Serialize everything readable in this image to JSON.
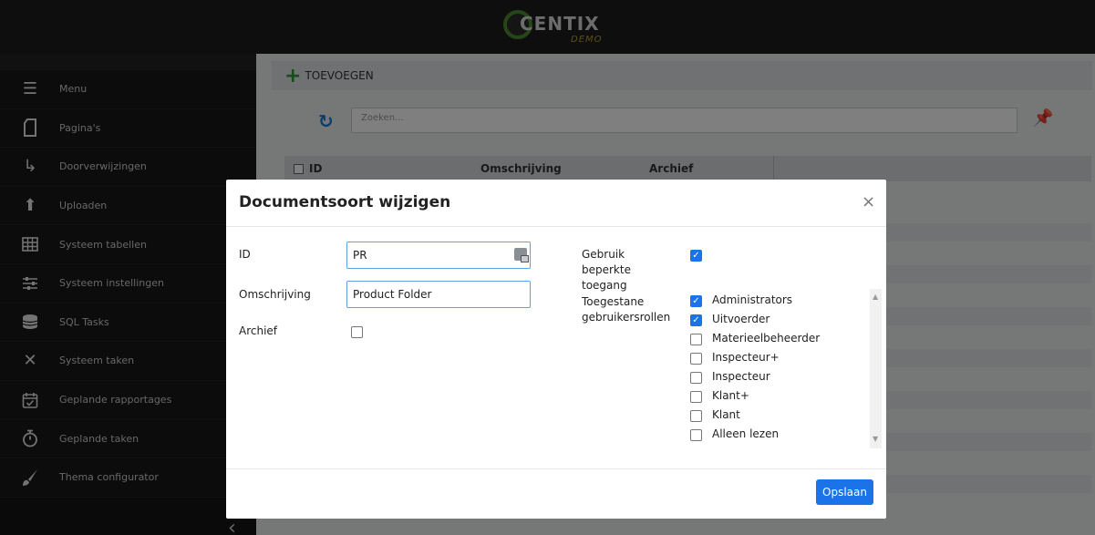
{
  "brand": {
    "name": "CENTIX",
    "tag": "DEMO"
  },
  "sidebar": {
    "items": [
      {
        "label": "Menu",
        "icon": "hamburger-icon"
      },
      {
        "label": "Pagina's",
        "icon": "page-icon"
      },
      {
        "label": "Doorverwijzingen",
        "icon": "redirect-arrow-icon"
      },
      {
        "label": "Uploaden",
        "icon": "upload-icon"
      },
      {
        "label": "Systeem tabellen",
        "icon": "table-icon"
      },
      {
        "label": "Systeem instellingen",
        "icon": "sliders-icon"
      },
      {
        "label": "SQL Tasks",
        "icon": "database-icon"
      },
      {
        "label": "Systeem taken",
        "icon": "tools-icon"
      },
      {
        "label": "Geplande rapportages",
        "icon": "calendar-check-icon"
      },
      {
        "label": "Geplande taken",
        "icon": "stopwatch-icon"
      },
      {
        "label": "Thema configurator",
        "icon": "brush-icon"
      }
    ]
  },
  "main": {
    "add_label": "TOEVOEGEN",
    "search_placeholder": "Zoeken...",
    "columns": [
      "ID",
      "Omschrijving",
      "Archief"
    ]
  },
  "modal": {
    "title": "Documentsoort wijzigen",
    "close": "×",
    "fields": {
      "id_label": "ID",
      "id_value": "PR",
      "omschrijving_label": "Omschrijving",
      "omschrijving_value": "Product Folder",
      "archief_label": "Archief",
      "archief_checked": false,
      "beperkt_label": "Gebruik beperkte toegang",
      "beperkt_checked": true,
      "rollen_label": "Toegestane gebruikersrollen"
    },
    "roles": [
      {
        "name": "Administrators",
        "checked": true
      },
      {
        "name": "Uitvoerder",
        "checked": true
      },
      {
        "name": "Materieelbeheerder",
        "checked": false
      },
      {
        "name": "Inspecteur+",
        "checked": false
      },
      {
        "name": "Inspecteur",
        "checked": false
      },
      {
        "name": "Klant+",
        "checked": false
      },
      {
        "name": "Klant",
        "checked": false
      },
      {
        "name": "Alleen lezen",
        "checked": false
      }
    ],
    "save_label": "Opslaan"
  },
  "colors": {
    "accent": "#1a73e8",
    "add": "#2e9b3a",
    "sidebar": "#141414"
  }
}
